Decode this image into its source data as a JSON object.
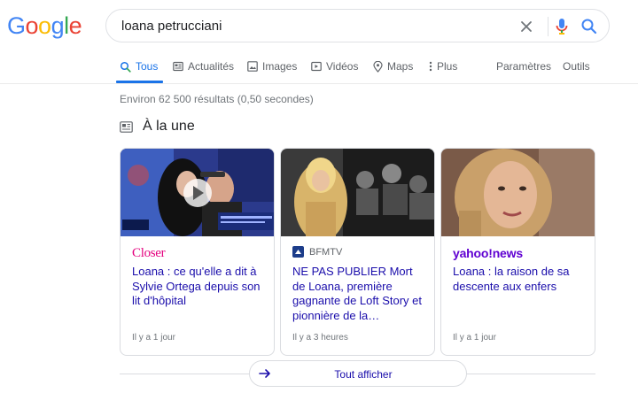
{
  "logo": {
    "text": "Google",
    "letters": [
      "G",
      "o",
      "o",
      "g",
      "l",
      "e"
    ],
    "colors": [
      "#4285f4",
      "#ea4335",
      "#fbbc05",
      "#4285f4",
      "#34a853",
      "#ea4335"
    ]
  },
  "search": {
    "query": "loana petrucciani",
    "clear_icon": "close-icon",
    "mic_icon": "microphone-icon",
    "search_icon": "search-icon"
  },
  "tabs": [
    {
      "label": "Tous",
      "icon": "search-icon",
      "active": true
    },
    {
      "label": "Actualités",
      "icon": "newspaper-icon",
      "active": false
    },
    {
      "label": "Images",
      "icon": "image-icon",
      "active": false
    },
    {
      "label": "Vidéos",
      "icon": "video-icon",
      "active": false
    },
    {
      "label": "Maps",
      "icon": "map-pin-icon",
      "active": false
    },
    {
      "label": "Plus",
      "icon": "more-vertical-icon",
      "active": false
    }
  ],
  "tools": {
    "settings": "Paramètres",
    "tools": "Outils"
  },
  "result_stats": "Environ 62 500 résultats (0,50 secondes)",
  "top_stories": {
    "title": "À la une",
    "icon": "news-icon",
    "cards": [
      {
        "source": "Closer",
        "title": "Loana : ce qu'elle a dit à Sylvie Ortega depuis son lit d'hôpital",
        "time": "Il y a 1 jour",
        "has_video": true
      },
      {
        "source": "BFMTV",
        "title": "NE PAS PUBLIER Mort de Loana, première gagnante de Loft Story et pionnière de la…",
        "time": "Il y a 3 heures",
        "has_video": false
      },
      {
        "source": "yahoo!news",
        "title": "Loana : la raison de sa descente aux enfers",
        "time": "Il y a 1 jour",
        "has_video": false
      }
    ],
    "show_all": "Tout afficher"
  },
  "colors": {
    "accent": "#1a73e8",
    "link": "#1a0dab",
    "muted": "#70757a"
  }
}
